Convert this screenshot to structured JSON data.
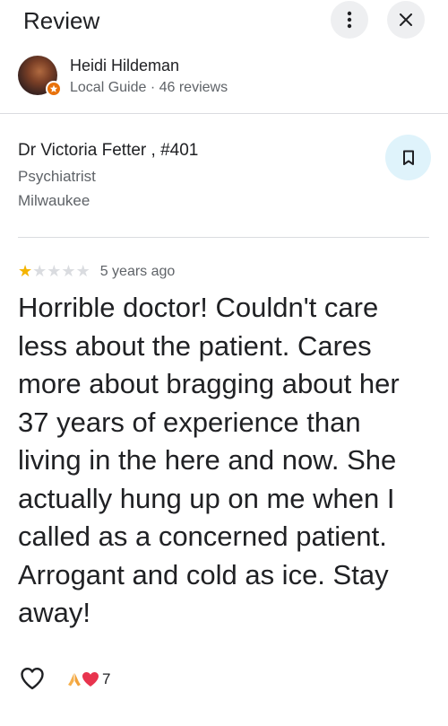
{
  "header": {
    "title": "Review",
    "more_icon": "more-vert-icon",
    "close_icon": "close-icon"
  },
  "author": {
    "name": "Heidi Hildeman",
    "meta": "Local Guide · 46 reviews",
    "badge_color": "#e8710a"
  },
  "place": {
    "name": "Dr Victoria Fetter , #401",
    "type": "Psychiatrist",
    "city": "Milwaukee",
    "save_icon": "bookmark-icon"
  },
  "review": {
    "rating": 1,
    "max_rating": 5,
    "age": "5 years ago",
    "text": "Horrible doctor! Couldn't care less about the patient. Cares more about bragging about her 37 years of experience than living in the here and now. She actually hung up on me when I called as a concerned patient. Arrogant and cold as ice. Stay away!"
  },
  "footer": {
    "like_icon": "heart-outline-icon",
    "reaction_icons": [
      "praying-hands-icon",
      "heart-icon"
    ],
    "reaction_count": "7"
  },
  "colors": {
    "star_on": "#f4b400",
    "star_off": "#dadce0",
    "save_bg": "#dff3fb"
  }
}
